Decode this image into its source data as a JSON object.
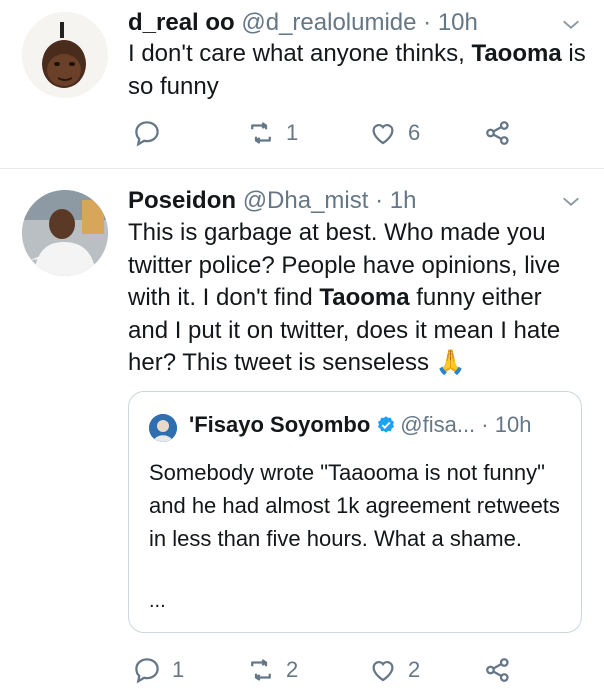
{
  "tweets": [
    {
      "name": "d_real oo",
      "handle": "@d_realolumide",
      "time": "· 10h",
      "text_before": "I don't care what anyone thinks, ",
      "text_bold": "Taooma",
      "text_after": " is so funny",
      "actions": {
        "replies": "",
        "retweets": "1",
        "likes": "6"
      }
    },
    {
      "name": "Poseidon",
      "handle": "@Dha_mist",
      "time": "· 1h",
      "text_before": "This is garbage at best. Who made you twitter police? People have opinions, live with it. I don't find ",
      "text_bold": "Taooma",
      "text_after": " funny either and I put it on twitter, does it mean I hate her? This tweet is senseless",
      "emoji": "🙏",
      "actions": {
        "replies": "1",
        "retweets": "2",
        "likes": "2"
      },
      "quoted": {
        "name": "'Fisayo Soyombo",
        "handle": "@fisa...",
        "time": "· 10h",
        "text": "Somebody wrote \"Taaooma is not funny\" and he had almost 1k agreement retweets in less than five hours. What a shame.",
        "more": "..."
      }
    }
  ],
  "colors": {
    "text": "#14171a",
    "secondary": "#657786",
    "border": "#e6ecf0",
    "verified": "#1da1f2"
  },
  "icons": [
    "chevron-down-icon",
    "reply-icon",
    "retweet-icon",
    "like-icon",
    "share-icon",
    "verified-icon"
  ]
}
